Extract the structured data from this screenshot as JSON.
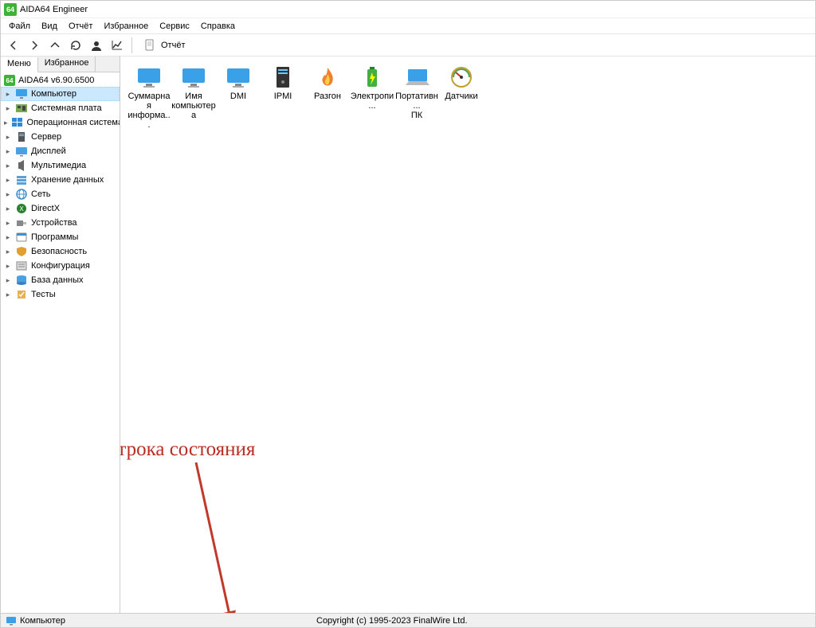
{
  "title": "AIDA64 Engineer",
  "app_icon_text": "64",
  "menubar": [
    "Файл",
    "Вид",
    "Отчёт",
    "Избранное",
    "Сервис",
    "Справка"
  ],
  "toolbar": {
    "back": "‹",
    "forward": "›",
    "up": "˄",
    "refresh": "↻",
    "profile": "👤",
    "graph": "📈",
    "report_icon": "📄",
    "report_label": "Отчёт"
  },
  "sidebar": {
    "tabs": {
      "menu": "Меню",
      "fav": "Избранное",
      "active": 0
    },
    "root": "AIDA64 v6.90.6500",
    "items": [
      {
        "label": "Компьютер",
        "selected": true,
        "icon": "monitor-blue"
      },
      {
        "label": "Системная плата",
        "selected": false,
        "icon": "board"
      },
      {
        "label": "Операционная система",
        "selected": false,
        "icon": "windows"
      },
      {
        "label": "Сервер",
        "selected": false,
        "icon": "server"
      },
      {
        "label": "Дисплей",
        "selected": false,
        "icon": "display"
      },
      {
        "label": "Мультимедиа",
        "selected": false,
        "icon": "speaker"
      },
      {
        "label": "Хранение данных",
        "selected": false,
        "icon": "storage"
      },
      {
        "label": "Сеть",
        "selected": false,
        "icon": "network"
      },
      {
        "label": "DirectX",
        "selected": false,
        "icon": "directx"
      },
      {
        "label": "Устройства",
        "selected": false,
        "icon": "device"
      },
      {
        "label": "Программы",
        "selected": false,
        "icon": "apps"
      },
      {
        "label": "Безопасность",
        "selected": false,
        "icon": "shield"
      },
      {
        "label": "Конфигурация",
        "selected": false,
        "icon": "config"
      },
      {
        "label": "База данных",
        "selected": false,
        "icon": "db"
      },
      {
        "label": "Тесты",
        "selected": false,
        "icon": "tests"
      }
    ]
  },
  "content": {
    "items": [
      {
        "label1": "Суммарная",
        "label2": "информа...",
        "icon": "monitor-blue"
      },
      {
        "label1": "Имя",
        "label2": "компьютера",
        "icon": "monitor-blue"
      },
      {
        "label1": "DMI",
        "label2": "",
        "icon": "monitor-blue"
      },
      {
        "label1": "IPMI",
        "label2": "",
        "icon": "server-tower"
      },
      {
        "label1": "Разгон",
        "label2": "",
        "icon": "flame"
      },
      {
        "label1": "Электропи...",
        "label2": "",
        "icon": "battery"
      },
      {
        "label1": "Портативн...",
        "label2": "ПК",
        "icon": "laptop"
      },
      {
        "label1": "Датчики",
        "label2": "",
        "icon": "gauge"
      }
    ]
  },
  "status": {
    "section": "Компьютер",
    "copyright": "Copyright (c) 1995-2023 FinalWire Ltd."
  },
  "annotation": {
    "text": "Строка состояния"
  }
}
